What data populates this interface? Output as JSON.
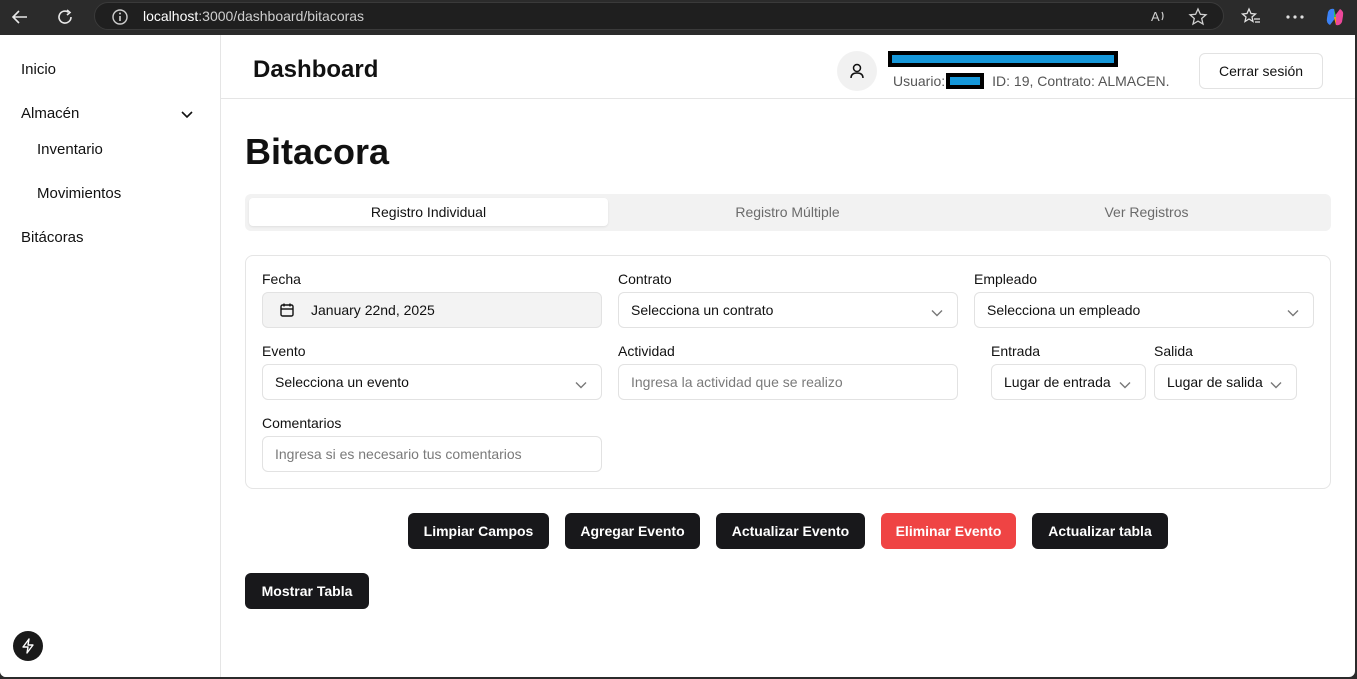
{
  "browser": {
    "url_host": "localhost",
    "url_rest": ":3000/dashboard/bitacoras"
  },
  "sidebar": {
    "items": [
      {
        "label": "Inicio"
      },
      {
        "label": "Almacén"
      },
      {
        "label": "Inventario"
      },
      {
        "label": "Movimientos"
      },
      {
        "label": "Bitácoras"
      }
    ]
  },
  "header": {
    "title": "Dashboard",
    "user_prefix": "Usuario:",
    "user_details": "ID: 19,  Contrato: ALMACEN.",
    "logout_label": "Cerrar sesión"
  },
  "main": {
    "heading": "Bitacora",
    "tabs": [
      {
        "label": "Registro Individual",
        "active": true
      },
      {
        "label": "Registro Múltiple",
        "active": false
      },
      {
        "label": "Ver Registros",
        "active": false
      }
    ]
  },
  "form": {
    "fecha": {
      "label": "Fecha",
      "value": "January 22nd, 2025"
    },
    "contrato": {
      "label": "Contrato",
      "value": "Selecciona un contrato"
    },
    "empleado": {
      "label": "Empleado",
      "value": "Selecciona un empleado"
    },
    "evento": {
      "label": "Evento",
      "value": "Selecciona un evento"
    },
    "actividad": {
      "label": "Actividad",
      "placeholder": "Ingresa la actividad que se realizo"
    },
    "entrada": {
      "label": "Entrada",
      "value": "Lugar de entrada"
    },
    "salida": {
      "label": "Salida",
      "value": "Lugar de salida"
    },
    "comentarios": {
      "label": "Comentarios",
      "placeholder": "Ingresa si es necesario tus comentarios"
    }
  },
  "actions": {
    "clear": "Limpiar Campos",
    "add": "Agregar Evento",
    "update": "Actualizar Evento",
    "delete": "Eliminar Evento",
    "refresh": "Actualizar tabla",
    "show_table": "Mostrar Tabla"
  },
  "colors": {
    "primary": "#18181b",
    "danger": "#ef4444",
    "redaction": "#1597d9"
  }
}
